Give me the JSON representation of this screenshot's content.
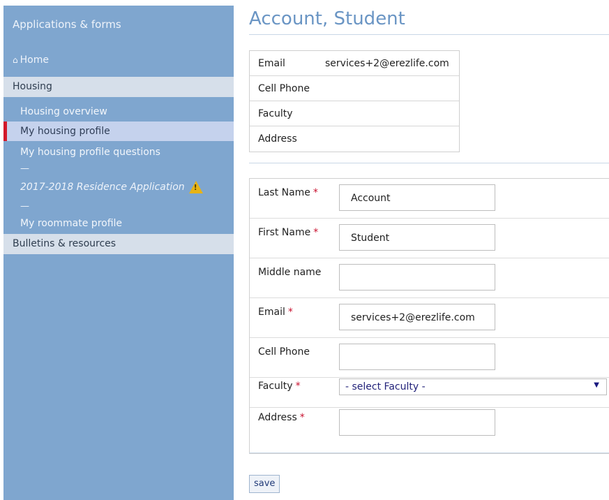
{
  "sidebar": {
    "title": "Applications & forms",
    "home": "Home",
    "sections": {
      "housing": "Housing",
      "bulletins": "Bulletins & resources"
    },
    "items": [
      "Housing overview",
      "My housing profile",
      "My housing profile questions",
      "2017-2018 Residence Application",
      "My roommate profile"
    ],
    "dash": "—",
    "warning_icon": "warning-triangle"
  },
  "page": {
    "title": "Account, Student"
  },
  "summary": [
    {
      "label": "Email",
      "value": "services+2@erezlife.com"
    },
    {
      "label": "Cell Phone",
      "value": ""
    },
    {
      "label": "Faculty",
      "value": ""
    },
    {
      "label": "Address",
      "value": ""
    }
  ],
  "form": {
    "last_name": {
      "label": "Last Name",
      "value": "Account"
    },
    "first_name": {
      "label": "First Name",
      "value": "Student"
    },
    "middle_name": {
      "label": "Middle name",
      "value": ""
    },
    "email": {
      "label": "Email",
      "value": "services+2@erezlife.com"
    },
    "cell_phone": {
      "label": "Cell Phone",
      "value": ""
    },
    "faculty": {
      "label": "Faculty",
      "selected": "- select Faculty -"
    },
    "address": {
      "label": "Address",
      "value": ""
    },
    "required_marker": "*"
  },
  "actions": {
    "save": "save"
  }
}
